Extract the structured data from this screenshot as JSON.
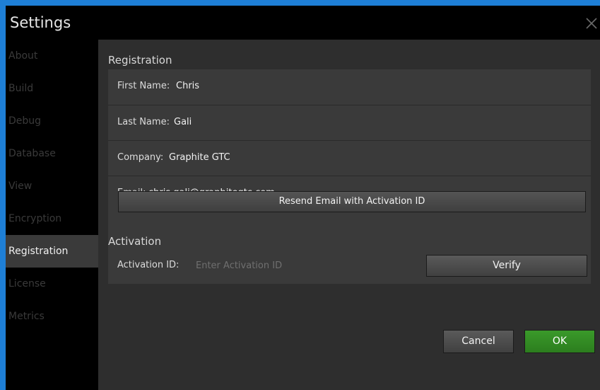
{
  "window": {
    "title": "Settings",
    "close_icon": "close-icon"
  },
  "sidebar": {
    "items": [
      {
        "label": "About"
      },
      {
        "label": "Build"
      },
      {
        "label": "Debug"
      },
      {
        "label": "Database"
      },
      {
        "label": "View"
      },
      {
        "label": "Encryption"
      },
      {
        "label": "Registration",
        "active": true
      },
      {
        "label": "License"
      },
      {
        "label": "Metrics"
      }
    ]
  },
  "registration": {
    "title": "Registration",
    "fields": [
      {
        "label": "First Name:",
        "value": "Chris"
      },
      {
        "label": "Last Name:",
        "value": "Gali"
      },
      {
        "label": "Company:",
        "value": "Graphite GTC"
      },
      {
        "label": "Email:",
        "value": "chris.gali@graphitegtc.com"
      }
    ],
    "resend_button": "Resend Email with Activation ID"
  },
  "activation": {
    "title": "Activation",
    "label": "Activation ID:",
    "input_value": "",
    "input_placeholder": "Enter Activation ID",
    "verify_button": "Verify"
  },
  "footer": {
    "cancel_label": "Cancel",
    "ok_label": "OK"
  },
  "colors": {
    "accent_border": "#1e7fd6",
    "ok_green": "#2f8a22",
    "active_nav_bg": "#3a3a3a"
  }
}
